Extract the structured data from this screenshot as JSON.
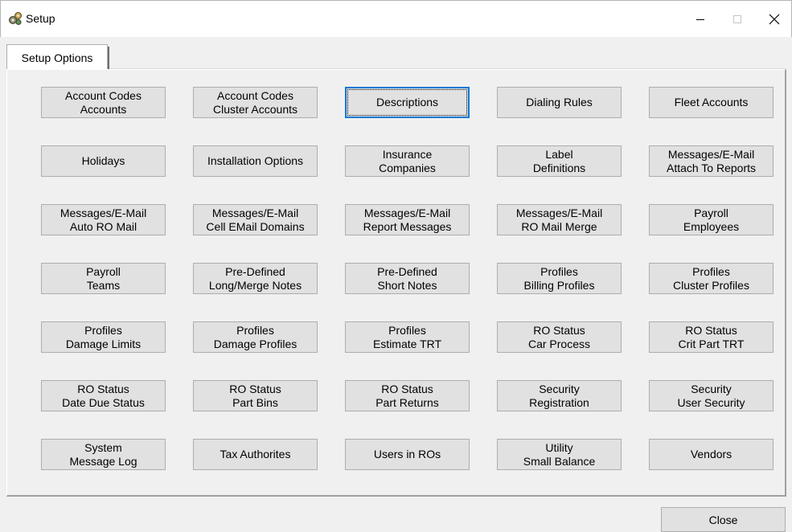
{
  "window": {
    "title": "Setup",
    "controls": {
      "minimize": "minimize",
      "maximize": "maximize",
      "close": "close"
    }
  },
  "tab": {
    "label": "Setup Options"
  },
  "buttons": [
    [
      "Account Codes",
      "Accounts"
    ],
    [
      "Account Codes",
      "Cluster Accounts"
    ],
    [
      "Descriptions"
    ],
    [
      "Dialing Rules"
    ],
    [
      "Fleet Accounts"
    ],
    [
      "Holidays"
    ],
    [
      "Installation Options"
    ],
    [
      "Insurance",
      "Companies"
    ],
    [
      "Label",
      "Definitions"
    ],
    [
      "Messages/E-Mail",
      "Attach To Reports"
    ],
    [
      "Messages/E-Mail",
      "Auto RO Mail"
    ],
    [
      "Messages/E-Mail",
      "Cell EMail Domains"
    ],
    [
      "Messages/E-Mail",
      "Report Messages"
    ],
    [
      "Messages/E-Mail",
      "RO Mail Merge"
    ],
    [
      "Payroll",
      "Employees"
    ],
    [
      "Payroll",
      "Teams"
    ],
    [
      "Pre-Defined",
      "Long/Merge Notes"
    ],
    [
      "Pre-Defined",
      "Short Notes"
    ],
    [
      "Profiles",
      "Billing Profiles"
    ],
    [
      "Profiles",
      "Cluster Profiles"
    ],
    [
      "Profiles",
      "Damage Limits"
    ],
    [
      "Profiles",
      "Damage Profiles"
    ],
    [
      "Profiles",
      "Estimate TRT"
    ],
    [
      "RO Status",
      "Car Process"
    ],
    [
      "RO Status",
      "Crit Part TRT"
    ],
    [
      "RO Status",
      "Date Due Status"
    ],
    [
      "RO Status",
      "Part Bins"
    ],
    [
      "RO Status",
      "Part Returns"
    ],
    [
      "Security",
      "Registration"
    ],
    [
      "Security",
      "User Security"
    ],
    [
      "System",
      "Message Log"
    ],
    [
      "Tax Authorites"
    ],
    [
      "Users in ROs"
    ],
    [
      "Utility",
      "Small Balance"
    ],
    [
      "Vendors"
    ]
  ],
  "focused_button": "Descriptions",
  "footer": {
    "close_label": "Close"
  },
  "colors": {
    "focus_border": "#0078d7",
    "button_face": "#e1e1e1",
    "window_bg": "#f0f0f0"
  }
}
